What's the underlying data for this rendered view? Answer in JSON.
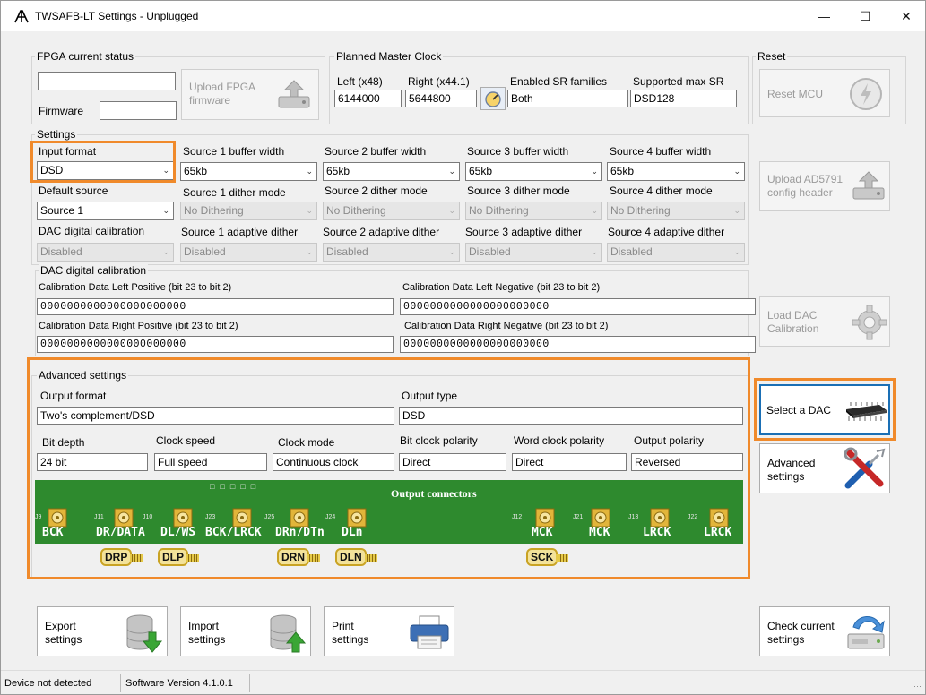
{
  "window": {
    "title": "TWSAFB-LT Settings - Unplugged",
    "minimize": "—",
    "maximize": "☐",
    "close": "✕"
  },
  "fpga": {
    "group_label": "FPGA current status",
    "status_value": "",
    "firmware_label": "Firmware",
    "firmware_value": "",
    "upload_button": "Upload FPGA firmware",
    "upload_line1": "Upload FPGA",
    "upload_line2": "firmware"
  },
  "master_clock": {
    "group_label": "Planned Master Clock",
    "left_label": "Left (x48)",
    "left_value": "6144000",
    "right_label": "Right (x44.1)",
    "right_value": "5644800",
    "sr_families_label": "Enabled SR families",
    "sr_families_value": "Both",
    "max_sr_label": "Supported max SR",
    "max_sr_value": "DSD128"
  },
  "reset": {
    "group_label": "Reset",
    "reset_button": "Reset MCU"
  },
  "settings": {
    "group_label": "Settings",
    "input_format_label": "Input format",
    "input_format_value": "DSD",
    "default_source_label": "Default source",
    "default_source_value": "Source 1",
    "dac_cal_label": "DAC digital calibration",
    "dac_cal_value": "Disabled",
    "sources": [
      {
        "buffer_label": "Source 1 buffer width",
        "buffer_value": "65kb",
        "dither_label": "Source 1 dither mode",
        "dither_value": "No Dithering",
        "adaptive_label": "Source 1 adaptive dither",
        "adaptive_value": "Disabled"
      },
      {
        "buffer_label": "Source 2 buffer width",
        "buffer_value": "65kb",
        "dither_label": "Source 2 dither mode",
        "dither_value": "No Dithering",
        "adaptive_label": "Source 2 adaptive dither",
        "adaptive_value": "Disabled"
      },
      {
        "buffer_label": "Source 3 buffer width",
        "buffer_value": "65kb",
        "dither_label": "Source 3 dither mode",
        "dither_value": "No Dithering",
        "adaptive_label": "Source 3 adaptive dither",
        "adaptive_value": "Disabled"
      },
      {
        "buffer_label": "Source 4 buffer width",
        "buffer_value": "65kb",
        "dither_label": "Source 4 dither mode",
        "dither_value": "No Dithering",
        "adaptive_label": "Source 4 adaptive dither",
        "adaptive_value": "Disabled"
      }
    ],
    "upload_ad_line1": "Upload AD5791",
    "upload_ad_line2": "config header"
  },
  "calibration": {
    "group_label": "DAC digital calibration",
    "left_pos_label": "Calibration Data Left Positive (bit 23 to bit 2)",
    "left_pos_value": "0000000000000000000000",
    "left_neg_label": "Calibration Data Left Negative (bit 23 to bit 2)",
    "left_neg_value": "0000000000000000000000",
    "right_pos_label": "Calibration Data Right Positive (bit 23 to bit 2)",
    "right_pos_value": "0000000000000000000000",
    "right_neg_label": "Calibration Data Right Negative (bit 23 to bit 2)",
    "right_neg_value": "0000000000000000000000",
    "load_line1": "Load DAC",
    "load_line2": "Calibration"
  },
  "advanced": {
    "group_label": "Advanced settings",
    "output_format_label": "Output format",
    "output_format_value": "Two's complement/DSD",
    "output_type_label": "Output type",
    "output_type_value": "DSD",
    "bit_depth_label": "Bit depth",
    "bit_depth_value": "24 bit",
    "clock_speed_label": "Clock speed",
    "clock_speed_value": "Full speed",
    "clock_mode_label": "Clock mode",
    "clock_mode_value": "Continuous clock",
    "bit_clock_pol_label": "Bit clock polarity",
    "bit_clock_pol_value": "Direct",
    "word_clock_pol_label": "Word clock polarity",
    "word_clock_pol_value": "Direct",
    "output_pol_label": "Output polarity",
    "output_pol_value": "Reversed"
  },
  "connectors": {
    "title": "Output connectors",
    "silk_labels": [
      "BCK",
      "DR/DATA",
      "DL/WS",
      "BCK/LRCK",
      "DRn/DTn",
      "DLn",
      "MCK",
      "MCK",
      "LRCK",
      "LRCK"
    ],
    "ref_labels": [
      "J9",
      "J11",
      "J10",
      "J23",
      "J25",
      "J24",
      "J12",
      "J21",
      "J13",
      "J22"
    ],
    "plugs": [
      "DRP",
      "DLP",
      "DRN",
      "DLN",
      "SCK"
    ]
  },
  "right_buttons": {
    "select_dac": "Select a DAC",
    "advanced_line1": "Advanced",
    "advanced_line2": "settings",
    "check_line1": "Check current",
    "check_line2": "settings"
  },
  "bottom_buttons": {
    "export_line1": "Export",
    "export_line2": "settings",
    "import_line1": "Import",
    "import_line2": "settings",
    "print_line1": "Print",
    "print_line2": "settings"
  },
  "statusbar": {
    "device": "Device not detected",
    "version": "Software Version 4.1.0.1"
  },
  "colors": {
    "highlight": "#f08a2b",
    "select_dac_border": "#1a6fb5",
    "pcb_green": "#2e8a2e"
  }
}
